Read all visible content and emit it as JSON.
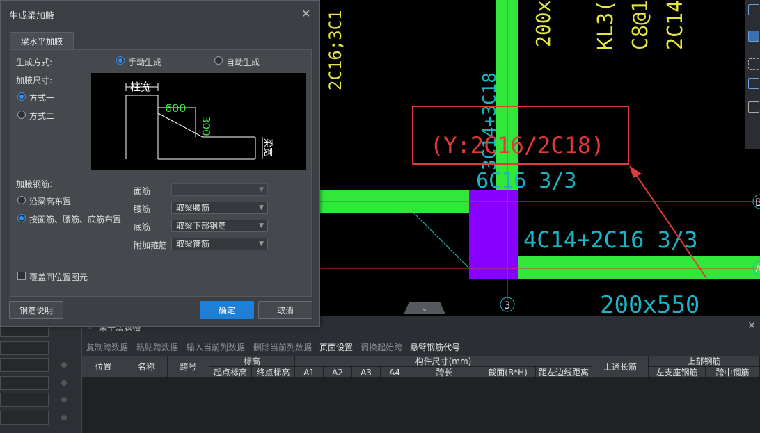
{
  "dialog": {
    "title": "生成梁加腋",
    "close_icon": "close-icon",
    "tab_label": "梁水平加腋",
    "generate_mode_label": "生成方式:",
    "manual_option": "手动生成",
    "auto_option": "自动生成",
    "haunch_size_label": "加腋尺寸:",
    "method1": "方式一",
    "method2": "方式二",
    "preview": {
      "col_width": "柱宽",
      "len": "600",
      "height": "300",
      "beam_width": "梁宽"
    },
    "rebar_label": "加腋钢筋:",
    "along_height_option": "沿梁高布置",
    "by_face_option": "按面筋、腰筋、底筋布置",
    "face_rebar_label": "面筋",
    "face_rebar_value": "",
    "waist_rebar_label": "腰筋",
    "waist_rebar_value": "取梁腰筋",
    "bottom_rebar_label": "底筋",
    "bottom_rebar_value": "取梁下部钢筋",
    "stirrup_label": "附加箍筋",
    "stirrup_value": "取梁箍筋",
    "overwrite_label": "覆盖同位置图元",
    "rebar_help_button": "钢筋说明",
    "ok_button": "确定",
    "cancel_button": "取消"
  },
  "cad": {
    "text_2c16": "2C16;3C1",
    "text_3c14": "3C14+3C18",
    "text_200x": "200x",
    "text_kl": "KL3(",
    "text_c8": "C8@1",
    "text_2c14": "2C14",
    "annotation": "(Y:2C16/2C18)",
    "text_6c16": "6C16 3/3",
    "text_4c14": "4C14+2C16 3/3",
    "text_200x550": "200x550",
    "axis_3": "3",
    "axis_b": "B",
    "axis_a": "A",
    "collapse_icon": "chevron-down-icon"
  },
  "colors": {
    "beam_green": "#33e63a",
    "column_purple": "#8800ff",
    "annotation_red": "#e23a3a",
    "cad_cyan": "#1ab4c4",
    "cad_yellow": "#e6e63c",
    "primary_blue": "#1e7fd6"
  },
  "table_panel": {
    "title": "梁平法表格",
    "toolbar": [
      "复制跨数据",
      "粘贴跨数据",
      "输入当前列数据",
      "删除当前列数据",
      "页面设置",
      "调换起始跨",
      "悬臂钢筋代号"
    ],
    "headers": {
      "pos": "位置",
      "name": "名称",
      "span": "跨号",
      "elev": "标高",
      "elev_start": "起点标高",
      "elev_end": "终点标高",
      "dims": "构件尺寸(mm)",
      "a1": "A1",
      "a2": "A2",
      "a3": "A3",
      "a4": "A4",
      "span_len": "跨长",
      "section": "截面(B*H)",
      "dist_left": "距左边线距离",
      "top_through": "上通长筋",
      "top_rebar": "上部钢筋",
      "left_support": "左支座钢筋",
      "mid_span": "跨中钢筋"
    }
  }
}
